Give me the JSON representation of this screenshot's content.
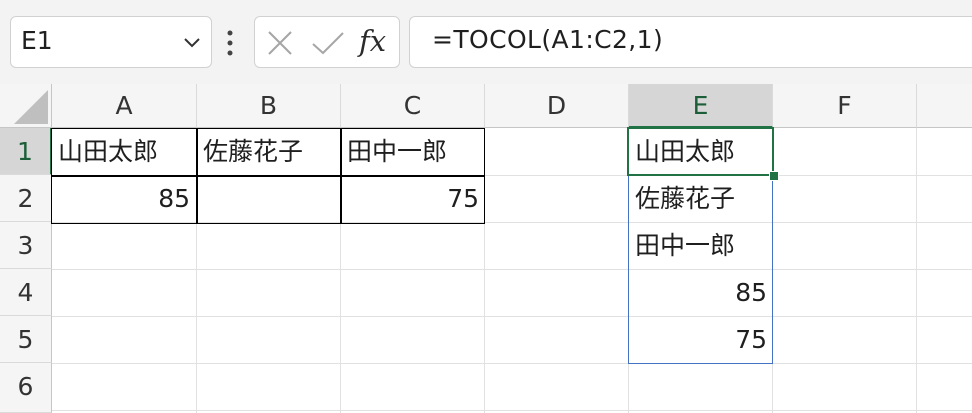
{
  "formula_bar": {
    "name_box_value": "E1",
    "fx_label": "fx",
    "formula": "=TOCOL(A1:C2,1)"
  },
  "columns": [
    "A",
    "B",
    "C",
    "D",
    "E",
    "F"
  ],
  "rows": [
    "1",
    "2",
    "3",
    "4",
    "5",
    "6"
  ],
  "cells": {
    "A1": "山田太郎",
    "B1": "佐藤花子",
    "C1": "田中一郎",
    "A2": "85",
    "C2": "75",
    "E1": "山田太郎",
    "E2": "佐藤花子",
    "E3": "田中一郎",
    "E4": "85",
    "E5": "75"
  },
  "colors": {
    "selection_green": "#217346",
    "spill_border_blue": "#4472c4"
  }
}
